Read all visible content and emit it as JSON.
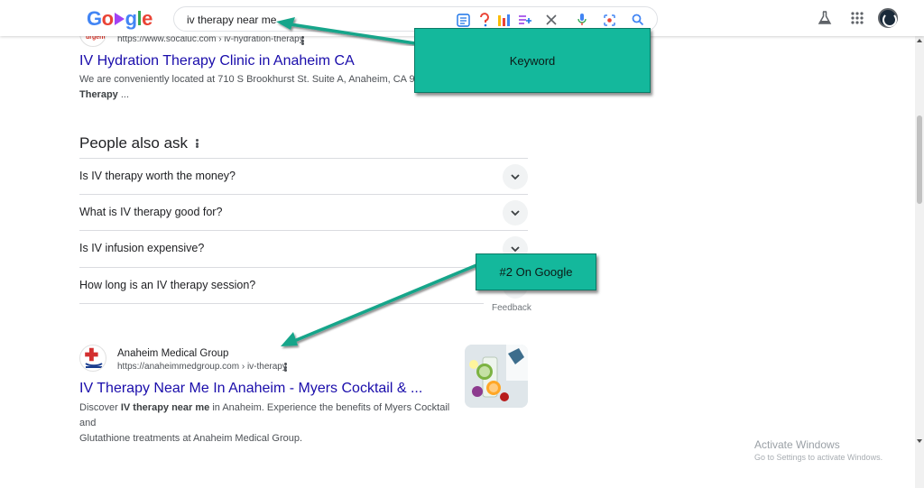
{
  "search": {
    "query": "iv therapy near me"
  },
  "logo": {
    "text": "Google"
  },
  "result1": {
    "favicon_text": "urgent",
    "url": "https://www.socaluc.com › iv-hydration-therapy",
    "title": "IV Hydration Therapy Clinic in Anaheim CA",
    "snippet_line1": "We are conveniently located at 710 S Brookhurst St. Suite A, Anaheim, CA 9280",
    "snippet_bold": "Therapy",
    "snippet_tail": " ..."
  },
  "paa": {
    "title": "People also ask",
    "questions": [
      "Is IV therapy worth the money?",
      "What is IV therapy good for?",
      "Is IV infusion expensive?",
      "How long is an IV therapy session?"
    ],
    "feedback": "Feedback"
  },
  "result2": {
    "site_name": "Anaheim Medical Group",
    "url": "https://anaheimmedgroup.com › iv-therapy",
    "title": "IV Therapy Near Me In Anaheim - Myers Cocktail & ...",
    "snippet_pre": "Discover ",
    "snippet_bold1": "IV therapy near me",
    "snippet_mid": " in Anaheim. Experience the benefits of Myers Cocktail and",
    "snippet_line2": "Glutathione treatments at Anaheim Medical Group."
  },
  "annotations": {
    "keyword": "Keyword",
    "rank": "#2 On Google"
  },
  "windows": {
    "line1": "Activate Windows",
    "line2": "Go to Settings to activate Windows."
  },
  "colors": {
    "callout": "#14b89c",
    "link": "#1a0dab",
    "arrow": "#17a58a"
  }
}
